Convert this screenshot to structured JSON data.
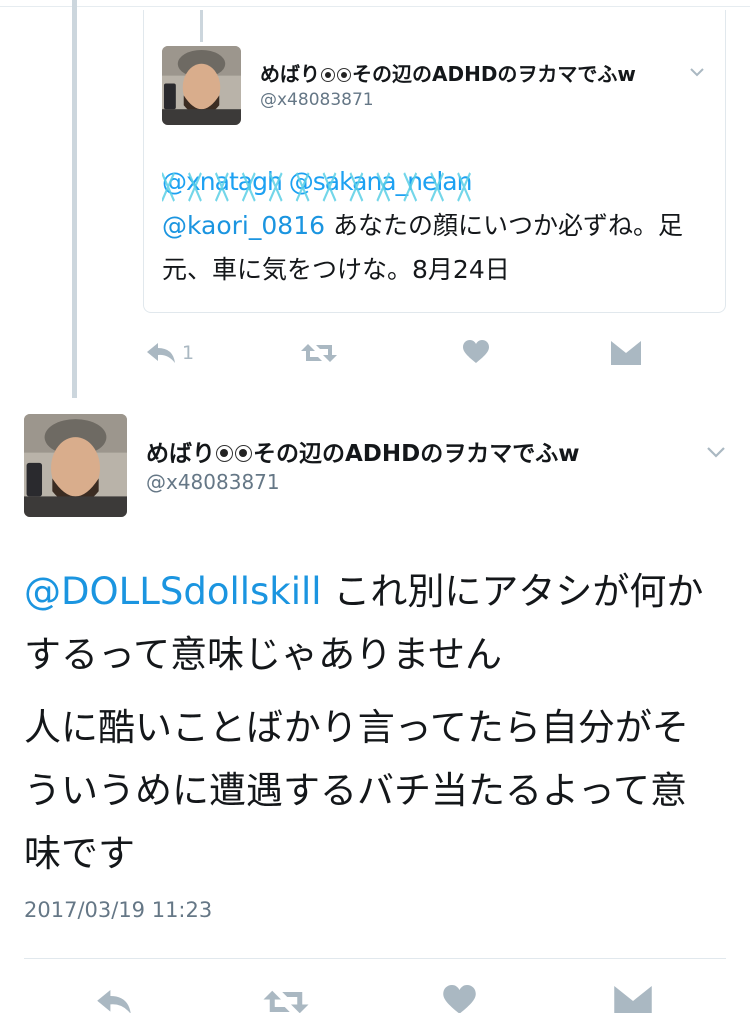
{
  "quoted_tweet": {
    "name_pre": "めばり",
    "name_post": "その辺のADHDのヲカマでふw",
    "handle": "@x48083871",
    "redacted_mentions": "@xnatagh @sakana_nelan",
    "mention": "@kaori_0816",
    "text": " あなたの顔にいつか必ずね。足元、車に気をつけな。8月24日",
    "reply_count": "1"
  },
  "main_tweet": {
    "name_pre": "めばり",
    "name_post": "その辺のADHDのヲカマでふw",
    "handle": "@x48083871",
    "mention": "@DOLLSdollskill",
    "line1": " これ別にアタシが何かするって意味じゃありません",
    "line2": "人に酷いことばかり言ってたら自分がそういうめに遭遇するバチ当たるよって意味です",
    "timestamp": "2017/03/19 11:23"
  },
  "colors": {
    "link": "#1b95e0",
    "icon": "#aab8c2",
    "secondary_text": "#657786"
  },
  "icons": [
    "reply-icon",
    "retweet-icon",
    "like-icon",
    "dm-icon",
    "chevron-down-icon"
  ]
}
